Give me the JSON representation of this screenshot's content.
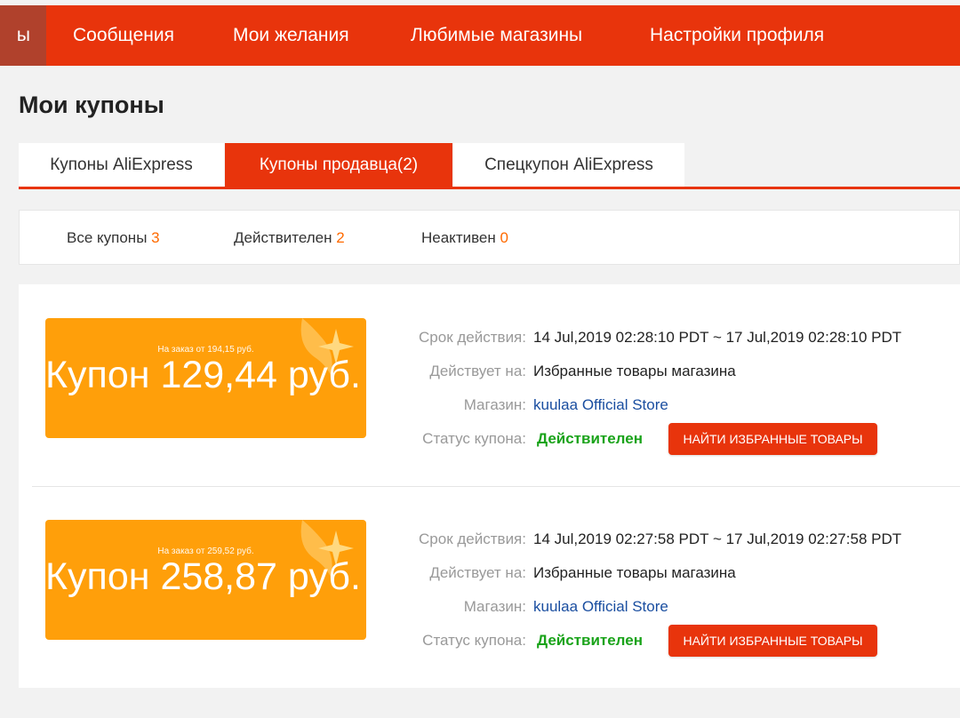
{
  "nav": {
    "cut_item": "ы",
    "items": [
      "Сообщения",
      "Мои желания",
      "Любимые магазины",
      "Настройки профиля"
    ]
  },
  "page_title": "Мои купоны",
  "tabs": [
    {
      "label": "Купоны AliExpress",
      "active": false
    },
    {
      "label": "Купоны продавца(2)",
      "active": true
    },
    {
      "label": "Спецкупон AliExpress",
      "active": false
    }
  ],
  "filters": [
    {
      "label": "Все купоны",
      "count": "3"
    },
    {
      "label": "Действителен",
      "count": "2"
    },
    {
      "label": "Неактивен",
      "count": "0"
    }
  ],
  "labels": {
    "validity": "Срок действия:",
    "applies": "Действует на:",
    "store": "Магазин:",
    "status": "Статус купона:",
    "button": "НАЙТИ ИЗБРАННЫЕ ТОВАРЫ"
  },
  "coupons": [
    {
      "min_order": "На заказ от 194,15 руб.",
      "amount": "Купон 129,44 руб.",
      "validity": "14 Jul,2019 02:28:10 PDT ~ 17 Jul,2019 02:28:10 PDT",
      "applies": "Избранные товары магазина",
      "store": "kuulaa Official Store",
      "status": "Действителен"
    },
    {
      "min_order": "На заказ от 259,52 руб.",
      "amount": "Купон 258,87 руб.",
      "validity": "14 Jul,2019 02:27:58 PDT ~ 17 Jul,2019 02:27:58 PDT",
      "applies": "Избранные товары магазина",
      "store": "kuulaa Official Store",
      "status": "Действителен"
    }
  ],
  "colors": {
    "brand_red": "#e8340c",
    "coupon_orange": "#ff9f0a",
    "count_orange": "#ff6a00",
    "status_green": "#1aa31a",
    "link_blue": "#1a4ea0"
  }
}
